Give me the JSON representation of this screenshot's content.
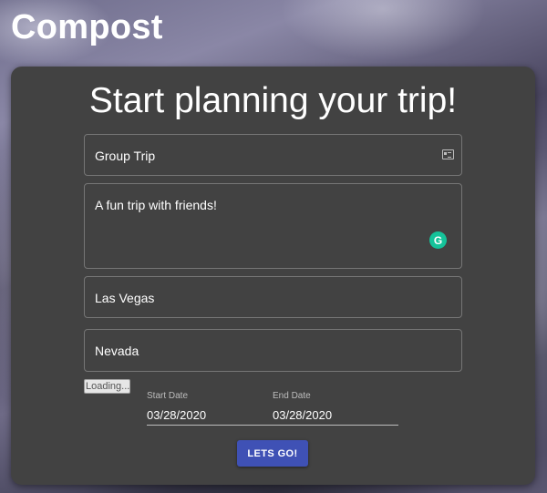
{
  "app": {
    "logo": "Compost"
  },
  "form": {
    "title": "Start planning your trip!",
    "trip_name": {
      "value": "Group Trip",
      "icon": "contact-card-icon"
    },
    "description": {
      "value": "A fun trip with friends!",
      "icon": "grammarly-icon",
      "icon_glyph": "G"
    },
    "city": {
      "value": "Las Vegas"
    },
    "state": {
      "value": "Nevada"
    },
    "loading_label": "Loading...",
    "start_date": {
      "label": "Start Date",
      "value": "03/28/2020"
    },
    "end_date": {
      "label": "End Date",
      "value": "03/28/2020"
    },
    "submit_label": "LETS GO!"
  },
  "colors": {
    "card_bg": "#424242",
    "button_bg": "#3f51b5",
    "grammarly": "#15c39a"
  }
}
